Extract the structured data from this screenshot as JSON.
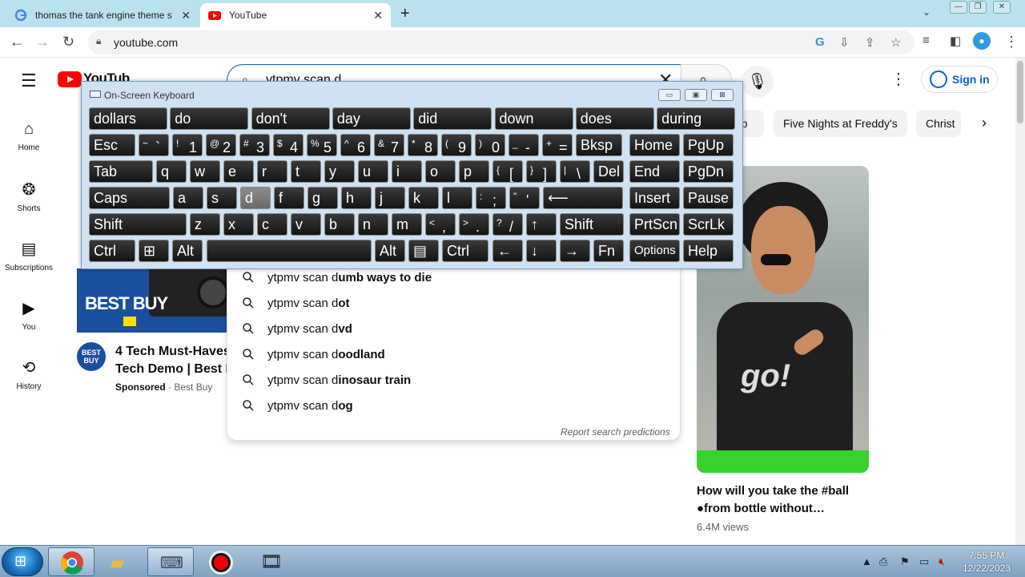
{
  "browser": {
    "tabs": [
      {
        "title": "thomas the tank engine theme s",
        "favicon": "google-icon",
        "active": false
      },
      {
        "title": "YouTube",
        "favicon": "youtube-icon",
        "active": true
      }
    ],
    "url": "youtube.com"
  },
  "youtube": {
    "logo_text": "YouTube",
    "search_query": "ytpmv scan d",
    "sign_in": "Sign in",
    "sidebar": [
      {
        "label": "Home",
        "icon": "home-icon"
      },
      {
        "label": "Shorts",
        "icon": "shorts-icon"
      },
      {
        "label": "Subscriptions",
        "icon": "subscriptions-icon"
      },
      {
        "label": "You",
        "icon": "you-icon"
      },
      {
        "label": "History",
        "icon": "history-icon"
      }
    ],
    "chips": [
      "up",
      "Five Nights at Freddy's",
      "Christ"
    ],
    "suggestions": [
      {
        "prefix": "ytpmv scan d",
        "suffix": "umb ways to die"
      },
      {
        "prefix": "ytpmv scan d",
        "suffix": "ot"
      },
      {
        "prefix": "ytpmv scan d",
        "suffix": "vd"
      },
      {
        "prefix": "ytpmv scan d",
        "suffix": "oodland"
      },
      {
        "prefix": "ytpmv scan d",
        "suffix": "inosaur train"
      },
      {
        "prefix": "ytpmv scan d",
        "suffix": "og"
      }
    ],
    "report_text": "Report search predictions",
    "ad": {
      "title_line1": "4 Tech Must-Haves",
      "title_line2": "Tech Demo | Best B",
      "sponsored": "Sponsored",
      "advertiser": "Best Buy",
      "brand_text": "BEST BUY"
    },
    "video": {
      "title": "How will you take the #ball ●from bottle without…",
      "views": "6.4M views",
      "shirt_print": "go!"
    }
  },
  "osk": {
    "title": "On-Screen Keyboard",
    "predictions": [
      "dollars",
      "do",
      "don't",
      "day",
      "did",
      "down",
      "does",
      "during"
    ],
    "row1": [
      {
        "shift": "",
        "main": "Esc"
      },
      {
        "shift": "~",
        "main": "`"
      },
      {
        "shift": "!",
        "main": "1"
      },
      {
        "shift": "@",
        "main": "2"
      },
      {
        "shift": "#",
        "main": "3"
      },
      {
        "shift": "$",
        "main": "4"
      },
      {
        "shift": "%",
        "main": "5"
      },
      {
        "shift": "^",
        "main": "6"
      },
      {
        "shift": "&",
        "main": "7"
      },
      {
        "shift": "*",
        "main": "8"
      },
      {
        "shift": "(",
        "main": "9"
      },
      {
        "shift": ")",
        "main": "0"
      },
      {
        "shift": "_",
        "main": "-"
      },
      {
        "shift": "+",
        "main": "="
      },
      {
        "shift": "",
        "main": "Bksp"
      },
      {
        "shift": "",
        "main": "Home"
      },
      {
        "shift": "",
        "main": "PgUp"
      }
    ],
    "row2": [
      "Tab",
      "q",
      "w",
      "e",
      "r",
      "t",
      "y",
      "u",
      "i",
      "o",
      "p",
      "[",
      "]",
      "\\",
      "Del",
      "End",
      "PgDn"
    ],
    "row2_shift": [
      "",
      "",
      "",
      "",
      "",
      "",
      "",
      "",
      "",
      "",
      "",
      "{",
      "}",
      "|",
      "",
      "",
      ""
    ],
    "row3": [
      "Caps",
      "a",
      "s",
      "d",
      "f",
      "g",
      "h",
      "j",
      "k",
      "l",
      ";",
      "'",
      "⟵",
      "Insert",
      "Pause"
    ],
    "row3_shift": [
      "",
      "",
      "",
      "",
      "",
      "",
      "",
      "",
      "",
      "",
      ":",
      "\"",
      "",
      "",
      ""
    ],
    "row4": [
      "Shift",
      "z",
      "x",
      "c",
      "v",
      "b",
      "n",
      "m",
      ",",
      ".",
      "/",
      "↑",
      "Shift",
      "PrtScn",
      "ScrLk"
    ],
    "row4_shift": [
      "",
      "",
      "",
      "",
      "",
      "",
      "",
      "",
      "<",
      ">",
      "?",
      "",
      "",
      "",
      ""
    ],
    "row5": [
      "Ctrl",
      "⊞",
      "Alt",
      "",
      "Alt",
      "▤",
      "Ctrl",
      "←",
      "↓",
      "→",
      "Fn",
      "Options",
      "Help"
    ]
  },
  "taskbar": {
    "time": "7:55 PM",
    "date": "12/22/2023"
  },
  "colors": {
    "tabstrip": "#b9e2ef",
    "yt_red": "#ff0000",
    "link_blue": "#065fd4",
    "osk_bg": "#cfe1f3",
    "key_bg": "#141414"
  }
}
